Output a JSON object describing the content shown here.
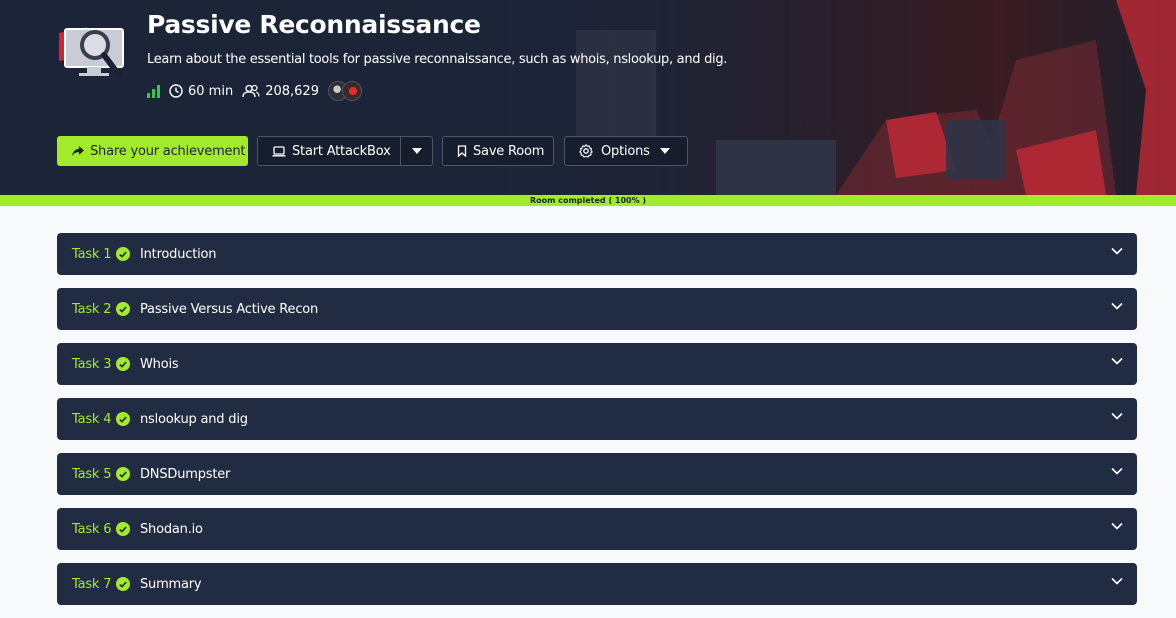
{
  "room": {
    "title": "Passive Reconnaissance",
    "description": "Learn about the essential tools for passive reconnaissance, such as whois, nslookup, and dig.",
    "duration": "60 min",
    "users": "208,629",
    "difficulty_icon": "signal-bars-icon"
  },
  "actions": {
    "share_label": "Share your achievement",
    "attackbox_label": "Start AttackBox",
    "save_label": "Save Room",
    "options_label": "Options"
  },
  "progress": {
    "label": "Room completed ( 100% )",
    "percent": 100
  },
  "tasks": [
    {
      "number": "Task 1",
      "title": "Introduction"
    },
    {
      "number": "Task 2",
      "title": "Passive Versus Active Recon"
    },
    {
      "number": "Task 3",
      "title": "Whois"
    },
    {
      "number": "Task 4",
      "title": "nslookup and dig"
    },
    {
      "number": "Task 5",
      "title": "DNSDumpster"
    },
    {
      "number": "Task 6",
      "title": "Shodan.io"
    },
    {
      "number": "Task 7",
      "title": "Summary"
    }
  ],
  "colors": {
    "accent": "#a3ea2a",
    "hero_bg": "#1c2538",
    "task_bg": "#212c42",
    "page_bg": "#f8f9fb"
  }
}
